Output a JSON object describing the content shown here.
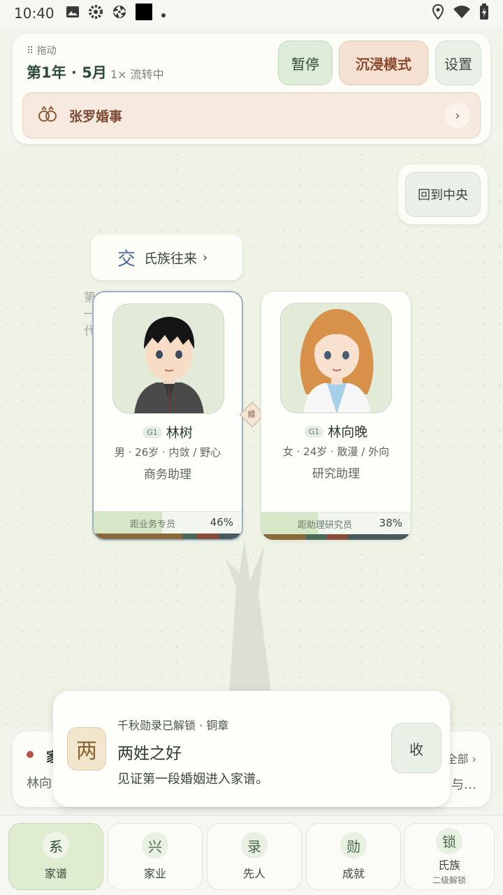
{
  "status_bar": {
    "time": "10:40"
  },
  "header": {
    "drag_label": "⠿ 拖动",
    "year_month": "第1年 · 5月",
    "speed_status": "1× 流转中",
    "pause_label": "暂停",
    "immerse_label": "沉浸模式",
    "settings_label": "设置",
    "event_title": "张罗婚事",
    "event_chevron": "›"
  },
  "map": {
    "center_button": "回到中央",
    "clan_pill_icon": "交",
    "clan_pill_label": "氏族往来",
    "clan_pill_arrow": "›",
    "generation_label": "第\n一\n代",
    "marriage_glyph": "婚"
  },
  "persons": [
    {
      "gen": "G1",
      "name": "林树",
      "traits": "男 · 26岁 · 内敛 / 野心",
      "job": "商务助理",
      "progress_label": "距业务专员",
      "progress_pct": "46%",
      "progress_value": 0.46
    },
    {
      "gen": "G1",
      "name": "林向晚",
      "traits": "女 · 24岁 · 散漫 / 外向",
      "job": "研究助理",
      "progress_label": "距助理研究员",
      "progress_pct": "38%",
      "progress_value": 0.38
    }
  ],
  "family_card": {
    "title": "家",
    "subtitle": "林向",
    "all_link": "全部 ›",
    "more_text": "与…"
  },
  "toast": {
    "icon_char": "两",
    "kicker": "千秋勋录已解锁 · 铜章",
    "title": "两姓之好",
    "description": "见证第一段婚姻进入家谱。",
    "collapse_label": "收"
  },
  "tabs": [
    {
      "icon": "系",
      "label": "家谱",
      "sub": ""
    },
    {
      "icon": "兴",
      "label": "家业",
      "sub": ""
    },
    {
      "icon": "录",
      "label": "先人",
      "sub": ""
    },
    {
      "icon": "勋",
      "label": "成就",
      "sub": ""
    },
    {
      "icon": "锁",
      "label": "氏族",
      "sub": "二级解锁"
    }
  ],
  "colors": {
    "accent_green": "#deecd0",
    "immerse_bg": "#f4e1d3",
    "event_bg": "#f6e9de"
  }
}
